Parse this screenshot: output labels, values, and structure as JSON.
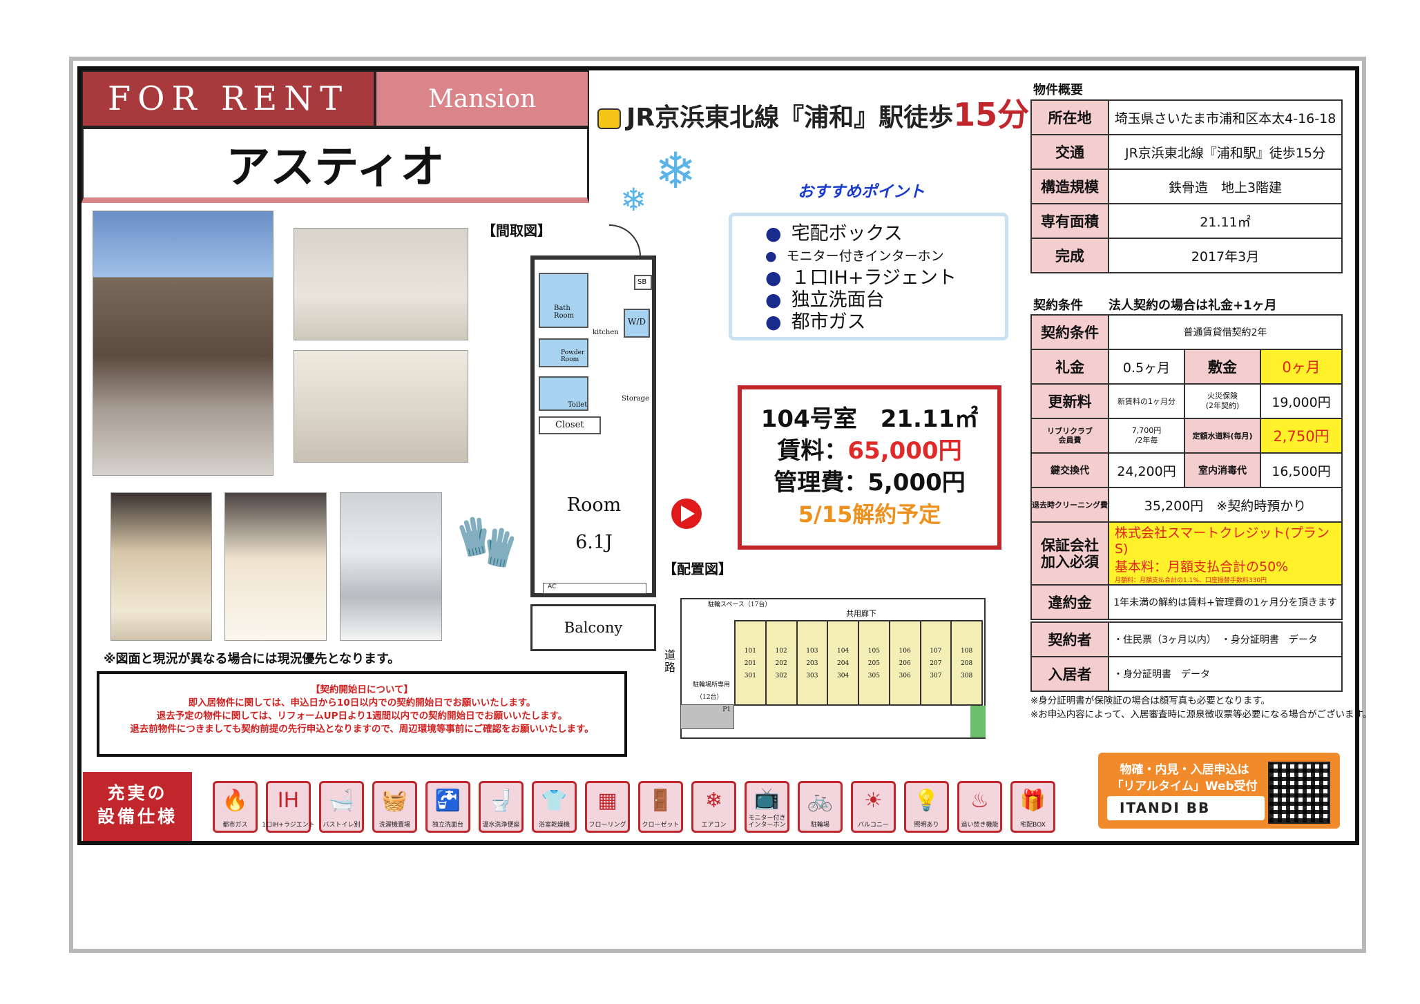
{
  "header": {
    "for_rent": "FOR  RENT",
    "type": "Mansion",
    "property_name": "アスティオ",
    "station_prefix": "JR京浜東北線『浦和』駅徒歩",
    "station_minutes": "15分"
  },
  "photos_note": "※図面と現況が異なる場合には現況優先となります。",
  "contract_start": {
    "title": "【契約開始日について】",
    "line1": "即入居物件に関しては、申込日から10日以内での契約開始日でお願いいたします。",
    "line2": "退去予定の物件に関しては、リフォームUP日より1週間以内での契約開始日でお願いいたします。",
    "line3": "退去前物件につきましても契約前提の先行申込となりますので、周辺環境等事前にご確認をお願いいたします。"
  },
  "floor_plan": {
    "title": "【間取図】",
    "bath": "Bath Room",
    "powder": "Powder Room",
    "toilet": "Toilet",
    "closet": "Closet",
    "kitchen": "kitchen",
    "wd": "W/D",
    "sb": "SB",
    "storage": "Storage",
    "room": "Room",
    "size": "6.1J",
    "ac": "AC",
    "balcony": "Balcony"
  },
  "recommend": {
    "title": "おすすめポイント",
    "items": [
      "宅配ボックス",
      "モニター付きインターホン",
      "１口IH+ラジェント",
      "独立洗面台",
      "都市ガス"
    ]
  },
  "price_box": {
    "room": "104号室　21.11㎡",
    "rent_label": "賃料：",
    "rent_value": "65,000円",
    "mgmt": "管理費：5,000円",
    "notice": "5/15解約予定"
  },
  "site_plan": {
    "title": "【配置図】",
    "bike": "駐輪スペース（17台）",
    "corridor": "共用廊下",
    "parking": "駐輪場所専用",
    "parking_count": "（12台）",
    "p1": "P1",
    "road": "道路",
    "units": [
      [
        "101",
        "201",
        "301"
      ],
      [
        "102",
        "202",
        "302"
      ],
      [
        "103",
        "203",
        "303"
      ],
      [
        "104",
        "204",
        "304"
      ],
      [
        "105",
        "205",
        "305"
      ],
      [
        "106",
        "206",
        "306"
      ],
      [
        "107",
        "207",
        "307"
      ],
      [
        "108",
        "208",
        "308"
      ]
    ]
  },
  "overview": {
    "title": "物件概要",
    "rows": [
      {
        "label": "所在地",
        "value": "埼玉県さいたま市浦和区本太4-16-18"
      },
      {
        "label": "交通",
        "value": "JR京浜東北線『浦和駅』徒歩15分"
      },
      {
        "label": "構造規模",
        "value": "鉄骨造　地上3階建"
      },
      {
        "label": "専有面積",
        "value": "21.11㎡"
      },
      {
        "label": "完成",
        "value": "2017年3月"
      }
    ]
  },
  "contract": {
    "title": "契約条件",
    "subtitle": "法人契約の場合は礼金+1ヶ月",
    "type_label": "契約条件",
    "type_value": "普通賃貸借契約2年",
    "key_money_label": "礼金",
    "key_money_value": "0.5ヶ月",
    "deposit_label": "敷金",
    "deposit_value": "0ヶ月",
    "renewal_label": "更新料",
    "renewal_value": "新賃料の1ヶ月分",
    "insurance_label": "火災保険\n(2年契約)",
    "insurance_value": "19,000円",
    "club_label": "リブリクラブ\n会員費",
    "club_value": "7,700円\n/2年毎",
    "water_label": "定額水道料(毎月)",
    "water_value": "2,750円",
    "key_change_label": "鍵交換代",
    "key_change_value": "24,200円",
    "disinfect_label": "室内消毒代",
    "disinfect_value": "16,500円",
    "cleaning_label": "退去時クリーニング費",
    "cleaning_value": "35,200円　※契約時預かり",
    "guarantor_label": "保証会社\n加入必須",
    "guarantor_1": "株式会社スマートクレジット(プランS)",
    "guarantor_2": "基本料：月額支払合計の50%",
    "guarantor_3": "月額料：月額支払合計の1.1%、口座振替手数料330円",
    "penalty_label": "違約金",
    "penalty_value": "1年未満の解約は賃料+管理費の1ヶ月分を頂きます"
  },
  "documents": {
    "contractor_label": "契約者",
    "contractor_value": "・住民票（3ヶ月以内）　・身分証明書　データ",
    "resident_label": "入居者",
    "resident_value": "・身分証明書　データ",
    "note1": "※身分証明書が保険証の場合は顔写真も必要となります。",
    "note2": "※お申込内容によって、入居審査時に源泉徴収票等必要になる場合がございます。"
  },
  "equipment": {
    "title_line1": "充実の",
    "title_line2": "設備仕様",
    "items": [
      {
        "label": "都市ガス",
        "icon": "🔥"
      },
      {
        "label": "1口IH+ラジエント",
        "icon": "IH"
      },
      {
        "label": "バストイレ別",
        "icon": "🛁"
      },
      {
        "label": "洗濯機置場",
        "icon": "🧺"
      },
      {
        "label": "独立洗面台",
        "icon": "🚰"
      },
      {
        "label": "温水洗浄便座",
        "icon": "🚽"
      },
      {
        "label": "浴室乾燥機",
        "icon": "👕"
      },
      {
        "label": "フローリング",
        "icon": "▦"
      },
      {
        "label": "クローゼット",
        "icon": "🚪"
      },
      {
        "label": "エアコン",
        "icon": "❄"
      },
      {
        "label": "モニター付き\nインターホン",
        "icon": "📺"
      },
      {
        "label": "駐輪場",
        "icon": "🚲"
      },
      {
        "label": "バルコニー",
        "icon": "☀"
      },
      {
        "label": "照明あり",
        "icon": "💡"
      },
      {
        "label": "追い焚き機能",
        "icon": "♨"
      },
      {
        "label": "宅配BOX",
        "icon": "🎁"
      }
    ]
  },
  "itandi": {
    "line1": "物確・内見・入居申込は",
    "line2": "「リアルタイム」Web受付",
    "logo": "ITANDI BB"
  },
  "colors": {
    "brand_red": "#a8393c",
    "pink": "#d9858a",
    "yellow": "#fff22a",
    "orange": "#f08a2b"
  }
}
